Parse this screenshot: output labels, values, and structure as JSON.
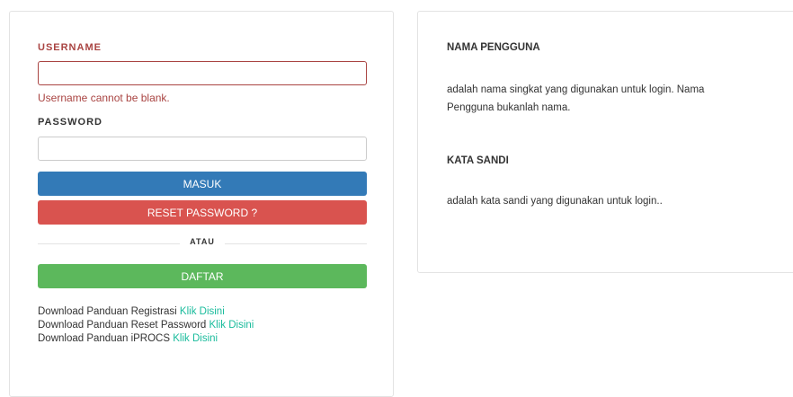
{
  "login": {
    "username_label": "USERNAME",
    "username_value": "",
    "username_error": "Username cannot be blank.",
    "password_label": "PASSWORD",
    "password_value": "",
    "masuk_label": "MASUK",
    "reset_label": "RESET PASSWORD ?",
    "divider_label": "ATAU",
    "daftar_label": "DAFTAR",
    "downloads": [
      {
        "text": "Download Panduan Registrasi",
        "link": "Klik Disini"
      },
      {
        "text": "Download Panduan Reset Password",
        "link": "Klik Disini"
      },
      {
        "text": "Download Panduan iPROCS",
        "link": "Klik Disini"
      }
    ]
  },
  "help": {
    "username_title": "NAMA PENGGUNA",
    "username_desc": "adalah nama singkat yang digunakan untuk login. Nama Pengguna bukanlah nama.",
    "password_title": "KATA SANDI",
    "password_desc": "adalah kata sandi yang digunakan untuk login.."
  },
  "colors": {
    "error": "#a94442",
    "primary": "#337ab7",
    "danger": "#d9534f",
    "success": "#5cb85c",
    "link": "#1abc9c"
  }
}
